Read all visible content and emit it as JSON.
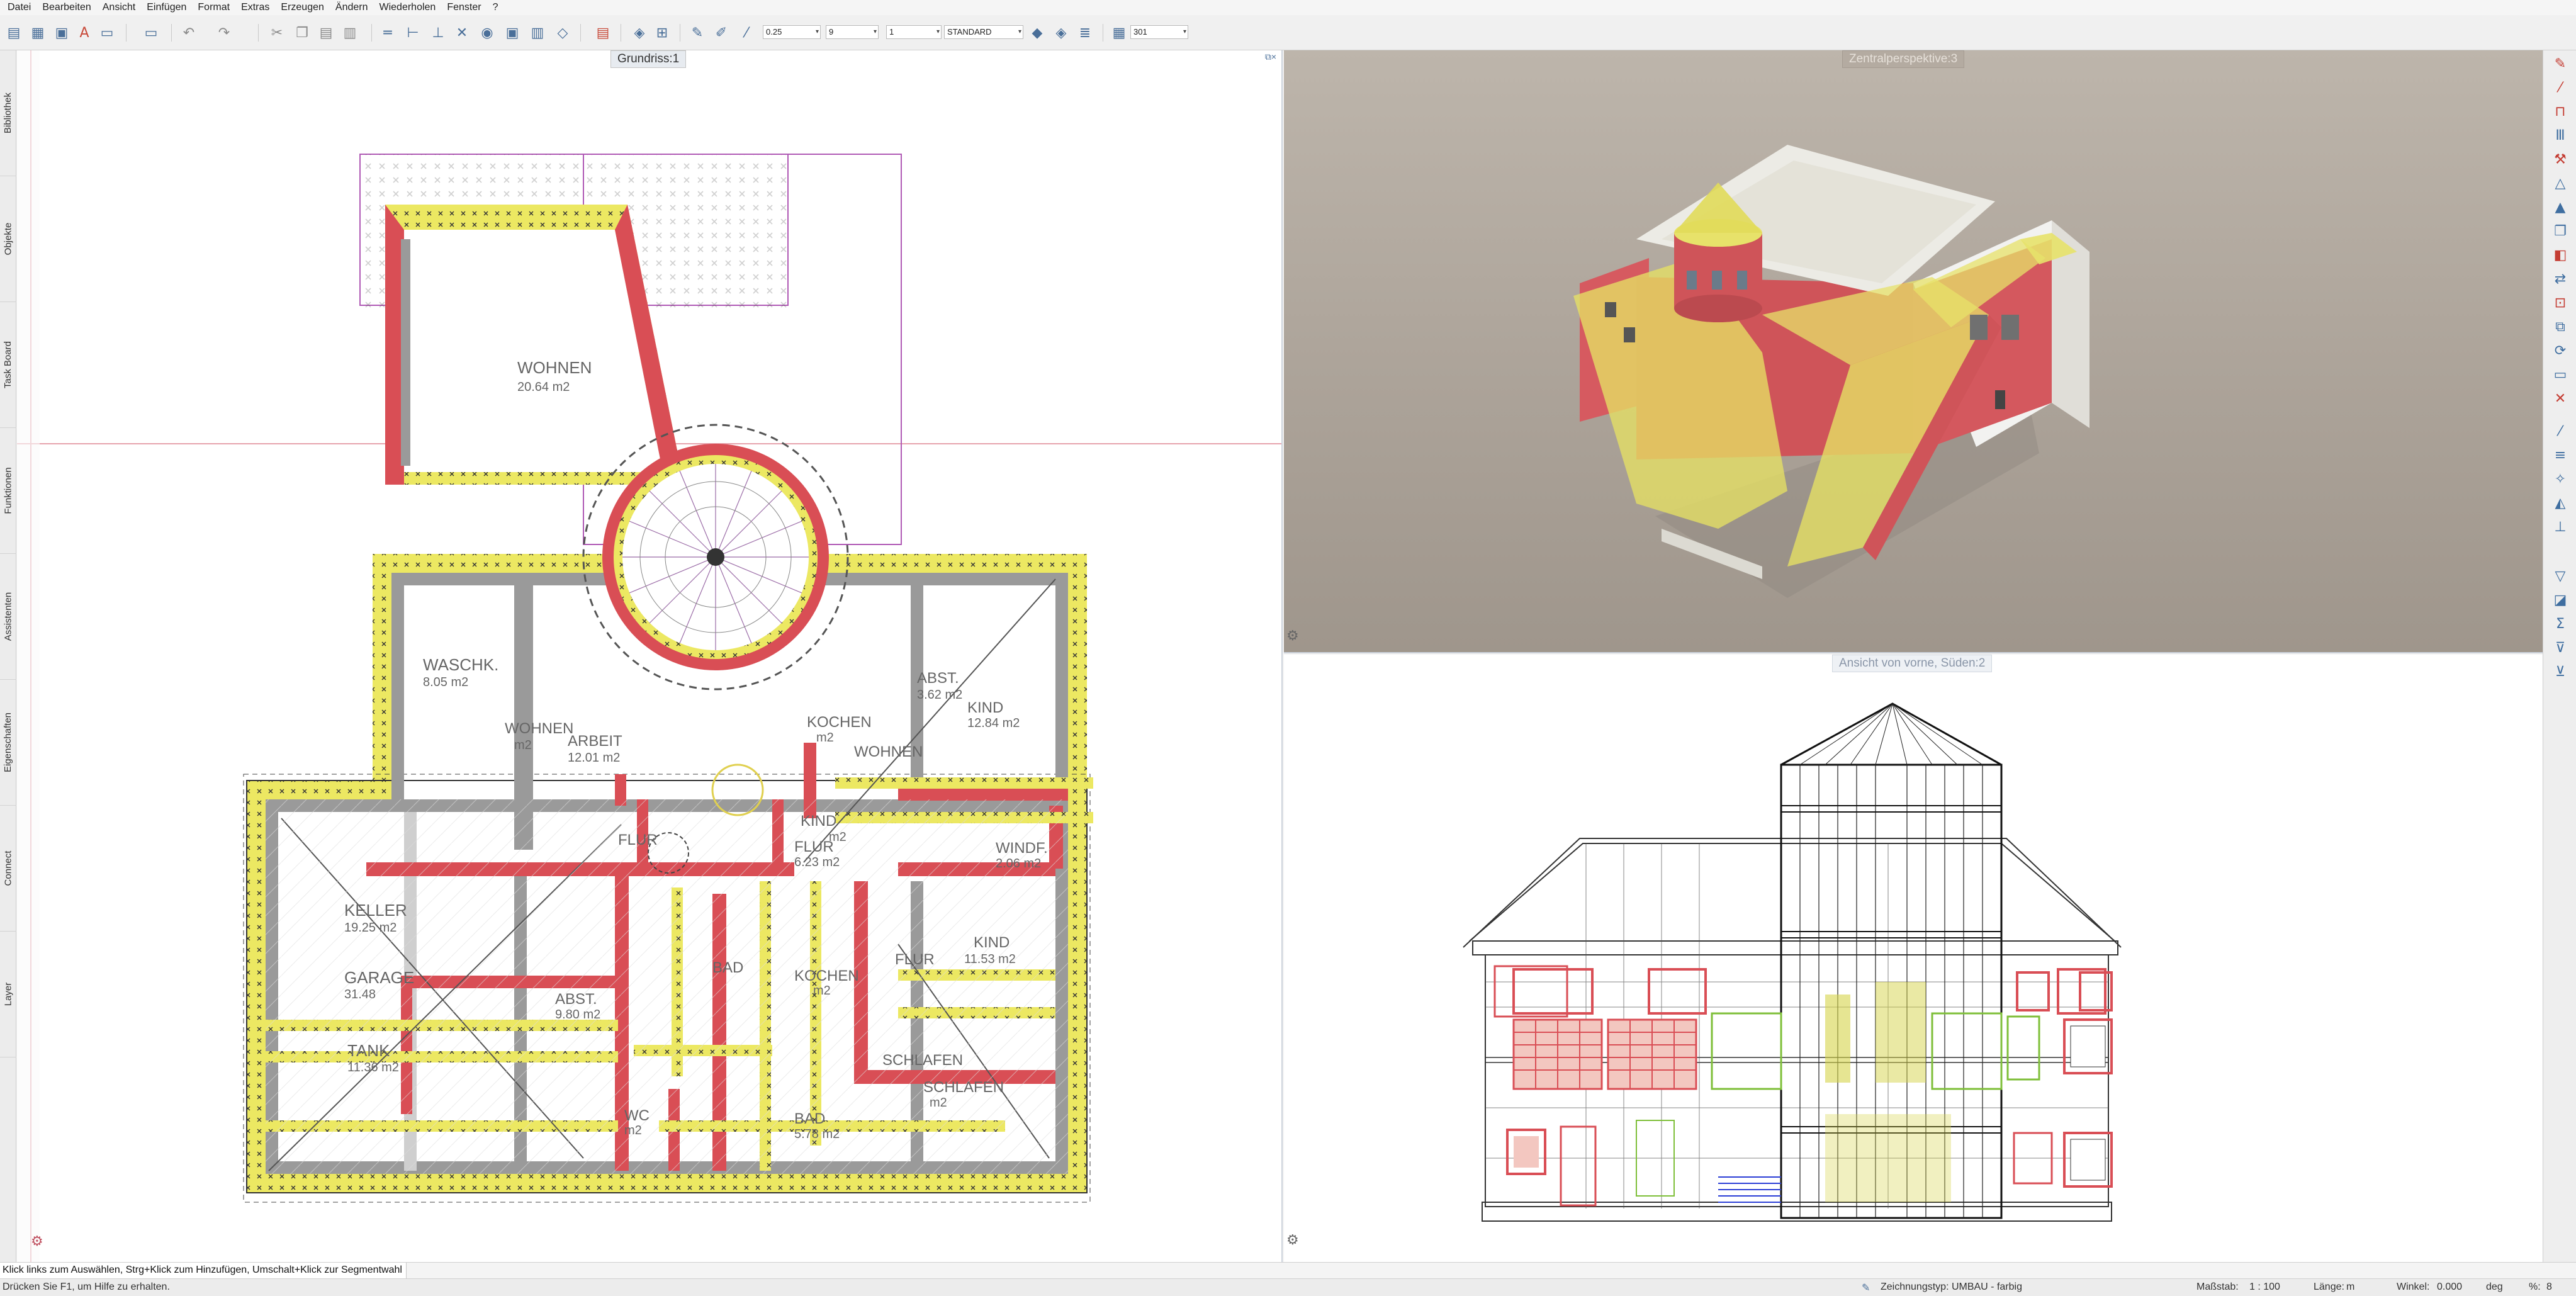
{
  "menu": [
    "Datei",
    "Bearbeiten",
    "Ansicht",
    "Einfügen",
    "Format",
    "Extras",
    "Erzeugen",
    "Ändern",
    "Wiederholen",
    "Fenster",
    "?"
  ],
  "toolbar": {
    "pen_thickness": "0.25",
    "line_type": "9",
    "line_color": "1",
    "layer": "STANDARD",
    "counter": "301"
  },
  "left_tabs": [
    "Bibliothek",
    "Objekte",
    "Task Board",
    "Funktionen",
    "Assistenten",
    "Eigenschaften",
    "Connect",
    "Layer"
  ],
  "viewports": {
    "plan_title": "Grundriss:1",
    "perspective_title": "Zentralperspektive:3",
    "elevation_title": "Ansicht von vorne, Süden:2"
  },
  "rooms": [
    {
      "name": "WOHNEN",
      "area": "20.64 m2"
    },
    {
      "name": "WASCHK.",
      "area": "8.05 m2"
    },
    {
      "name": "WOHNEN",
      "area": "m2"
    },
    {
      "name": "ARBEIT",
      "area": "12.01 m2"
    },
    {
      "name": "KOCHEN",
      "area": "m2"
    },
    {
      "name": "WOHNEN",
      "area": ""
    },
    {
      "name": "ABST.",
      "area": "3.62 m2"
    },
    {
      "name": "KIND",
      "area": "12.84 m2"
    },
    {
      "name": "KIND",
      "area": "m2"
    },
    {
      "name": "FLUR",
      "area": "6.23 m2"
    },
    {
      "name": "FLUR",
      "area": ""
    },
    {
      "name": "WINDF.",
      "area": "2.06 m2"
    },
    {
      "name": "KELLER",
      "area": "19.25 m2"
    },
    {
      "name": "GARAGE",
      "area": "31.48"
    },
    {
      "name": "TANK",
      "area": "11.36 m2"
    },
    {
      "name": "ABST.",
      "area": "9.80 m2"
    },
    {
      "name": "BAD",
      "area": ""
    },
    {
      "name": "KOCHEN",
      "area": "m2"
    },
    {
      "name": "FLUR",
      "area": ""
    },
    {
      "name": "KIND",
      "area": "11.53 m2"
    },
    {
      "name": "SCHLAFEN",
      "area": ""
    },
    {
      "name": "SCHLAFEN",
      "area": "m2"
    },
    {
      "name": "BAD",
      "area": "5.78 m2"
    },
    {
      "name": "WC",
      "area": "m2"
    }
  ],
  "hint": "Klick links zum Auswählen, Strg+Klick zum Hinzufügen, Umschalt+Klick zur Segmentwahl",
  "status": {
    "help": "Drücken Sie F1, um Hilfe zu erhalten.",
    "drawing_type": "Zeichnungstyp: UMBAU - farbig",
    "scale_label": "Maßstab:",
    "scale": "1 : 100",
    "length_label": "Länge:",
    "length_unit": "m",
    "angle_label": "Winkel:",
    "angle": "0.000",
    "angle_unit": "deg",
    "percent_label": "%:",
    "percent": "8"
  },
  "colors": {
    "wall_red": "#d94e55",
    "hatch_yellow": "#e8e45a",
    "wall_grey": "#9a9a9a",
    "accent_blue": "#3f6ea0"
  }
}
